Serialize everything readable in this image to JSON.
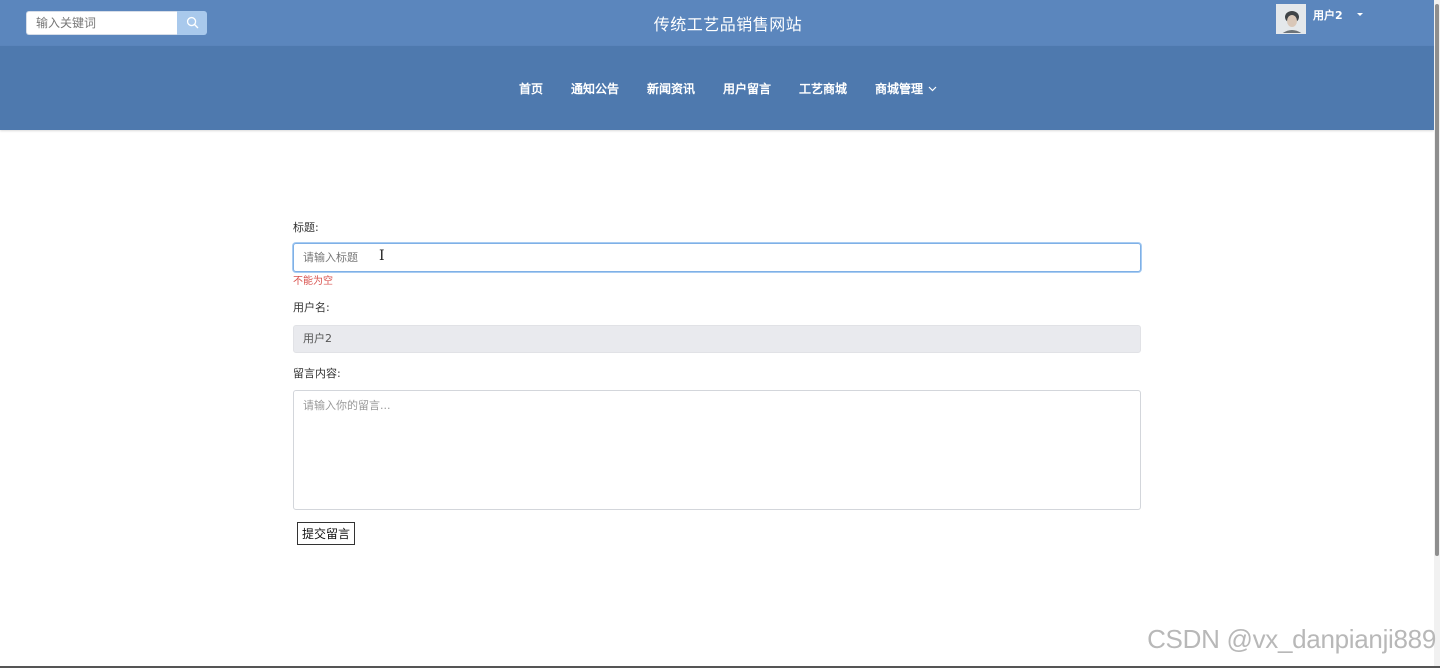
{
  "header": {
    "search_placeholder": "输入关键词",
    "site_title": "传统工艺品销售网站",
    "user_name": "用户2"
  },
  "nav": {
    "items": [
      "首页",
      "通知公告",
      "新闻资讯",
      "用户留言",
      "工艺商城"
    ],
    "dropdown_label": "商城管理"
  },
  "form": {
    "title_label": "标题:",
    "title_placeholder": "请输入标题",
    "title_error": "不能为空",
    "username_label": "用户名:",
    "username_value": "用户2",
    "content_label": "留言内容:",
    "content_placeholder": "请输入你的留言...",
    "submit_label": "提交留言"
  },
  "watermark": "CSDN @vx_danpianji889",
  "colors": {
    "topbar": "#5b86bd",
    "navbar": "#4e79ae",
    "error": "#d9534f"
  }
}
